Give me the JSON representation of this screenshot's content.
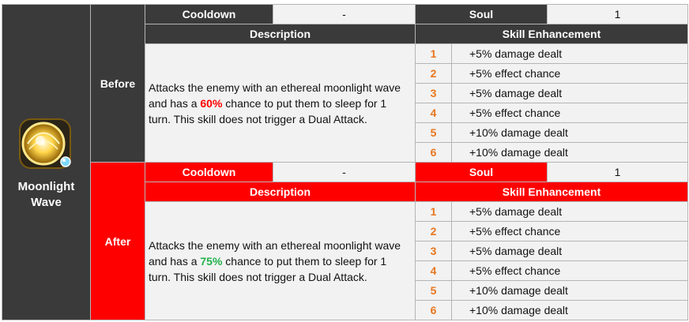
{
  "skill": {
    "name_line1": "Moonlight",
    "name_line2": "Wave",
    "icon": "moonlight-wave-skill-icon"
  },
  "labels": {
    "cooldown": "Cooldown",
    "soul": "Soul",
    "description": "Description",
    "enhancement": "Skill Enhancement"
  },
  "before": {
    "phase": "Before",
    "cooldown_value": "-",
    "soul_value": "1",
    "desc_pre": "Attacks the enemy with an ethereal moonlight wave and has a ",
    "desc_highlight": "60%",
    "desc_post": " chance to put them to sleep for 1 turn. This skill does not trigger a Dual Attack.",
    "enhancements": [
      {
        "level": "1",
        "text": "+5% damage dealt"
      },
      {
        "level": "2",
        "text": "+5% effect chance"
      },
      {
        "level": "3",
        "text": "+5% damage dealt"
      },
      {
        "level": "4",
        "text": "+5% effect chance"
      },
      {
        "level": "5",
        "text": "+10% damage dealt"
      },
      {
        "level": "6",
        "text": "+10% damage dealt"
      }
    ]
  },
  "after": {
    "phase": "After",
    "cooldown_value": "-",
    "soul_value": "1",
    "desc_pre": "Attacks the enemy with an ethereal moonlight wave and has a ",
    "desc_highlight": "75%",
    "desc_post": " chance to put them to sleep for 1 turn. This skill does not trigger a Dual Attack.",
    "enhancements": [
      {
        "level": "1",
        "text": "+5% damage dealt"
      },
      {
        "level": "2",
        "text": "+5% effect chance"
      },
      {
        "level": "3",
        "text": "+5% damage dealt"
      },
      {
        "level": "4",
        "text": "+5% effect chance"
      },
      {
        "level": "5",
        "text": "+10% damage dealt"
      },
      {
        "level": "6",
        "text": "+10% damage dealt"
      }
    ]
  },
  "colors": {
    "header_dark": "#3a3a3a",
    "header_red": "#ff0000",
    "level_number": "#e8761e",
    "chance_before": "#ff0000",
    "chance_after": "#22b24c"
  }
}
